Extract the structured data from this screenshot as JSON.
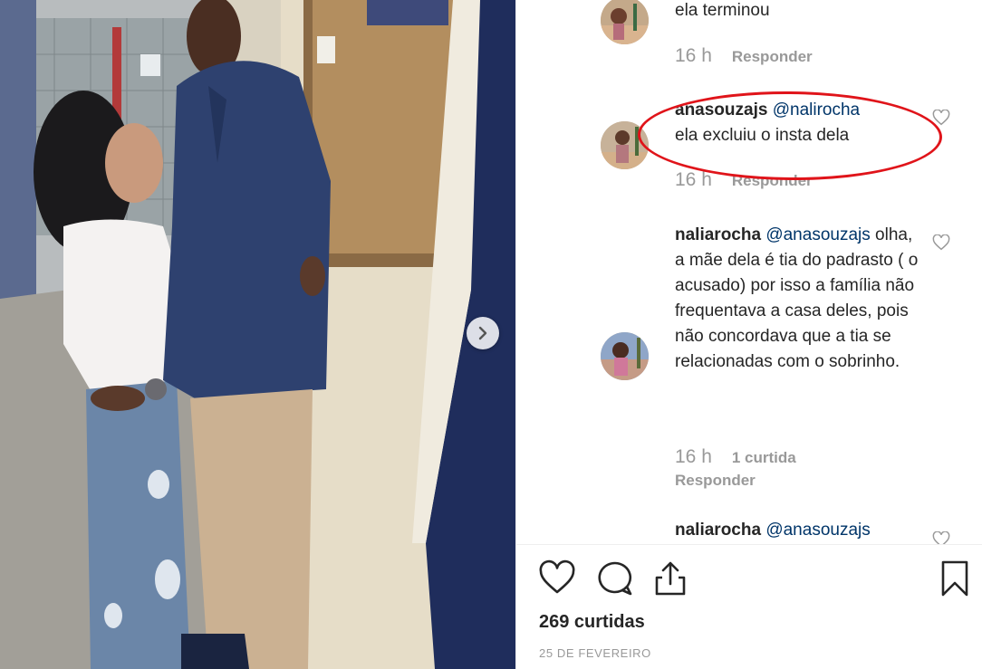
{
  "photo": {
    "next_icon": "chevron-right-icon"
  },
  "comments": [
    {
      "text": "ela terminou",
      "time": "16 h",
      "reply": "Responder"
    },
    {
      "user": "anasouzajs",
      "mention": "@nalirocha",
      "text": "ela excluiu o insta dela",
      "time": "16 h",
      "reply": "Responder"
    },
    {
      "user": "naliarocha",
      "mention": "@anasouzajs",
      "text": "olha, a mãe dela é tia do padrasto ( o acusado) por isso a família não frequentava a casa deles, pois não concordava que a tia se relacionadas com o sobrinho.",
      "time": "16 h",
      "likes": "1 curtida",
      "reply": "Responder"
    },
    {
      "user": "naliarocha",
      "mention": "@anasouzajs"
    }
  ],
  "actions": {
    "icons": [
      "heart-icon",
      "comment-icon",
      "share-icon",
      "bookmark-icon"
    ]
  },
  "post": {
    "likes": "269 curtidas",
    "date": "25 DE FEVEREIRO"
  },
  "colors": {
    "mention": "#003569",
    "meta": "#999999",
    "highlight": "#e0141a"
  }
}
